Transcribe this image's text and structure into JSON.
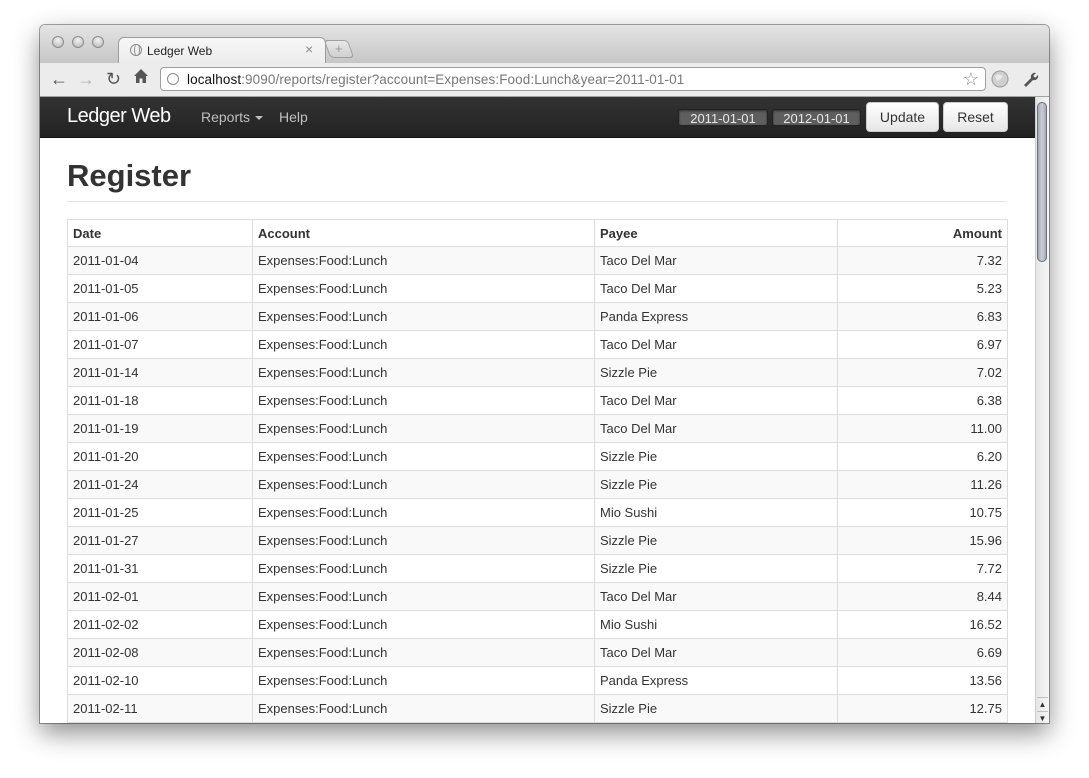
{
  "browser": {
    "tab_title": "Ledger Web",
    "new_tab_symbol": "+",
    "url_host": "localhost",
    "url_rest": ":9090/reports/register?account=Expenses:Food:Lunch&year=2011-01-01"
  },
  "navbar": {
    "brand": "Ledger Web",
    "reports_label": "Reports",
    "help_label": "Help",
    "from_date": "2011-01-01",
    "to_date": "2012-01-01",
    "update_label": "Update",
    "reset_label": "Reset"
  },
  "page": {
    "title": "Register"
  },
  "table": {
    "headers": [
      "Date",
      "Account",
      "Payee",
      "Amount"
    ],
    "rows": [
      [
        "2011-01-04",
        "Expenses:Food:Lunch",
        "Taco Del Mar",
        "7.32"
      ],
      [
        "2011-01-05",
        "Expenses:Food:Lunch",
        "Taco Del Mar",
        "5.23"
      ],
      [
        "2011-01-06",
        "Expenses:Food:Lunch",
        "Panda Express",
        "6.83"
      ],
      [
        "2011-01-07",
        "Expenses:Food:Lunch",
        "Taco Del Mar",
        "6.97"
      ],
      [
        "2011-01-14",
        "Expenses:Food:Lunch",
        "Sizzle Pie",
        "7.02"
      ],
      [
        "2011-01-18",
        "Expenses:Food:Lunch",
        "Taco Del Mar",
        "6.38"
      ],
      [
        "2011-01-19",
        "Expenses:Food:Lunch",
        "Taco Del Mar",
        "11.00"
      ],
      [
        "2011-01-20",
        "Expenses:Food:Lunch",
        "Sizzle Pie",
        "6.20"
      ],
      [
        "2011-01-24",
        "Expenses:Food:Lunch",
        "Sizzle Pie",
        "11.26"
      ],
      [
        "2011-01-25",
        "Expenses:Food:Lunch",
        "Mio Sushi",
        "10.75"
      ],
      [
        "2011-01-27",
        "Expenses:Food:Lunch",
        "Sizzle Pie",
        "15.96"
      ],
      [
        "2011-01-31",
        "Expenses:Food:Lunch",
        "Sizzle Pie",
        "7.72"
      ],
      [
        "2011-02-01",
        "Expenses:Food:Lunch",
        "Taco Del Mar",
        "8.44"
      ],
      [
        "2011-02-02",
        "Expenses:Food:Lunch",
        "Mio Sushi",
        "16.52"
      ],
      [
        "2011-02-08",
        "Expenses:Food:Lunch",
        "Taco Del Mar",
        "6.69"
      ],
      [
        "2011-02-10",
        "Expenses:Food:Lunch",
        "Panda Express",
        "13.56"
      ],
      [
        "2011-02-11",
        "Expenses:Food:Lunch",
        "Sizzle Pie",
        "12.75"
      ]
    ]
  },
  "icons": {
    "back": "back-arrow-icon",
    "forward": "forward-arrow-icon",
    "reload": "reload-icon",
    "home": "home-icon",
    "bookmark": "star-icon",
    "extension": "globe-extension-icon",
    "settings": "wrench-icon"
  },
  "colors": {
    "navbar": "#222222",
    "striped_row": "#f9f9f9",
    "table_border": "#dddddd"
  }
}
